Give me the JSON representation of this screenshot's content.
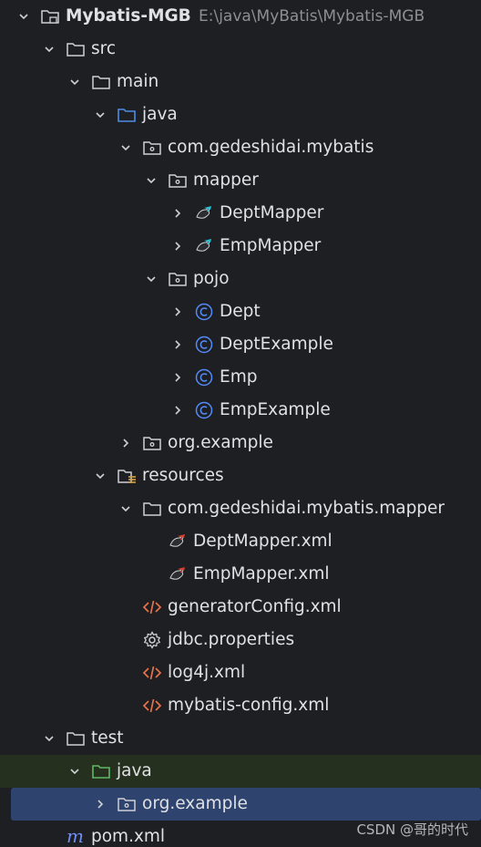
{
  "project": {
    "name": "Mybatis-MGB",
    "path": "E:\\java\\MyBatis\\Mybatis-MGB"
  },
  "tree": [
    {
      "label": "src",
      "icon": "folder-icon",
      "expanded": true
    },
    {
      "label": "main",
      "icon": "folder-icon",
      "expanded": true
    },
    {
      "label": "java",
      "icon": "source-folder-icon",
      "expanded": true
    },
    {
      "label": "com.gedeshidai.mybatis",
      "icon": "package-icon",
      "expanded": true
    },
    {
      "label": "mapper",
      "icon": "package-icon",
      "expanded": true
    },
    {
      "label": "DeptMapper",
      "icon": "mybatis-mapper-icon",
      "expanded": false
    },
    {
      "label": "EmpMapper",
      "icon": "mybatis-mapper-icon",
      "expanded": false
    },
    {
      "label": "pojo",
      "icon": "package-icon",
      "expanded": true
    },
    {
      "label": "Dept",
      "icon": "class-icon",
      "expanded": false
    },
    {
      "label": "DeptExample",
      "icon": "class-icon",
      "expanded": false
    },
    {
      "label": "Emp",
      "icon": "class-icon",
      "expanded": false
    },
    {
      "label": "EmpExample",
      "icon": "class-icon",
      "expanded": false
    },
    {
      "label": "org.example",
      "icon": "package-icon",
      "expanded": false
    },
    {
      "label": "resources",
      "icon": "resources-folder-icon",
      "expanded": true
    },
    {
      "label": "com.gedeshidai.mybatis.mapper",
      "icon": "folder-icon",
      "expanded": true
    },
    {
      "label": "DeptMapper.xml",
      "icon": "mybatis-xml-icon"
    },
    {
      "label": "EmpMapper.xml",
      "icon": "mybatis-xml-icon"
    },
    {
      "label": "generatorConfig.xml",
      "icon": "xml-icon"
    },
    {
      "label": "jdbc.properties",
      "icon": "gear-icon"
    },
    {
      "label": "log4j.xml",
      "icon": "xml-icon"
    },
    {
      "label": "mybatis-config.xml",
      "icon": "xml-icon"
    },
    {
      "label": "test",
      "icon": "folder-icon",
      "expanded": true
    },
    {
      "label": "java",
      "icon": "test-folder-icon",
      "expanded": true
    },
    {
      "label": "org.example",
      "icon": "package-icon",
      "expanded": false,
      "selected": true
    },
    {
      "label": "pom.xml",
      "icon": "maven-icon"
    }
  ],
  "watermark": "CSDN @哥的时代",
  "colors": {
    "background": "#1e1f22",
    "selection": "#2e436e",
    "test_root_highlight": "#25301f",
    "source_folder": "#4d8ce6",
    "test_folder": "#5fb865",
    "class_icon": "#548af7",
    "xml_icon": "#e8734a",
    "maven_icon": "#6f8ff5"
  }
}
